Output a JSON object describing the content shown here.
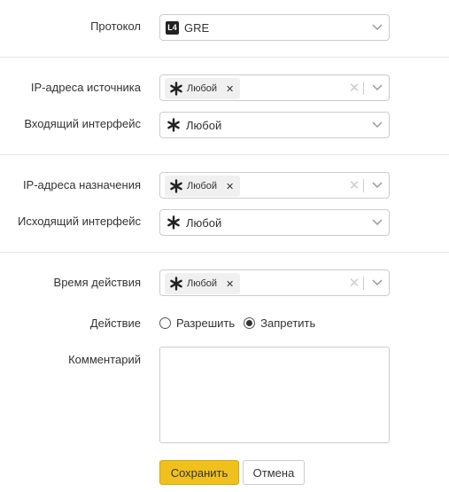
{
  "form": {
    "protocol": {
      "label": "Протокол",
      "value": "GRE",
      "badge": "L4"
    },
    "source_ip": {
      "label": "IP-адреса источника",
      "tag": "Любой"
    },
    "incoming_iface": {
      "label": "Входящий интерфейс",
      "value": "Любой"
    },
    "dest_ip": {
      "label": "IP-адреса назначения",
      "tag": "Любой"
    },
    "outgoing_iface": {
      "label": "Исходящий интерфейс",
      "value": "Любой"
    },
    "time": {
      "label": "Время действия",
      "tag": "Любой"
    },
    "action": {
      "label": "Действие",
      "options": [
        "Разрешить",
        "Запретить"
      ],
      "selected": "Запретить"
    },
    "comment": {
      "label": "Комментарий",
      "value": ""
    }
  },
  "buttons": {
    "save": "Сохранить",
    "cancel": "Отмена"
  },
  "colors": {
    "save_bg": "#f0c01c",
    "border": "#cccccc",
    "separator": "#e6e6e6"
  },
  "icons": {
    "any": "asterisk-icon",
    "remove": "close-icon",
    "dropdown": "chevron-down-icon",
    "protocol": "l4-badge-icon"
  }
}
